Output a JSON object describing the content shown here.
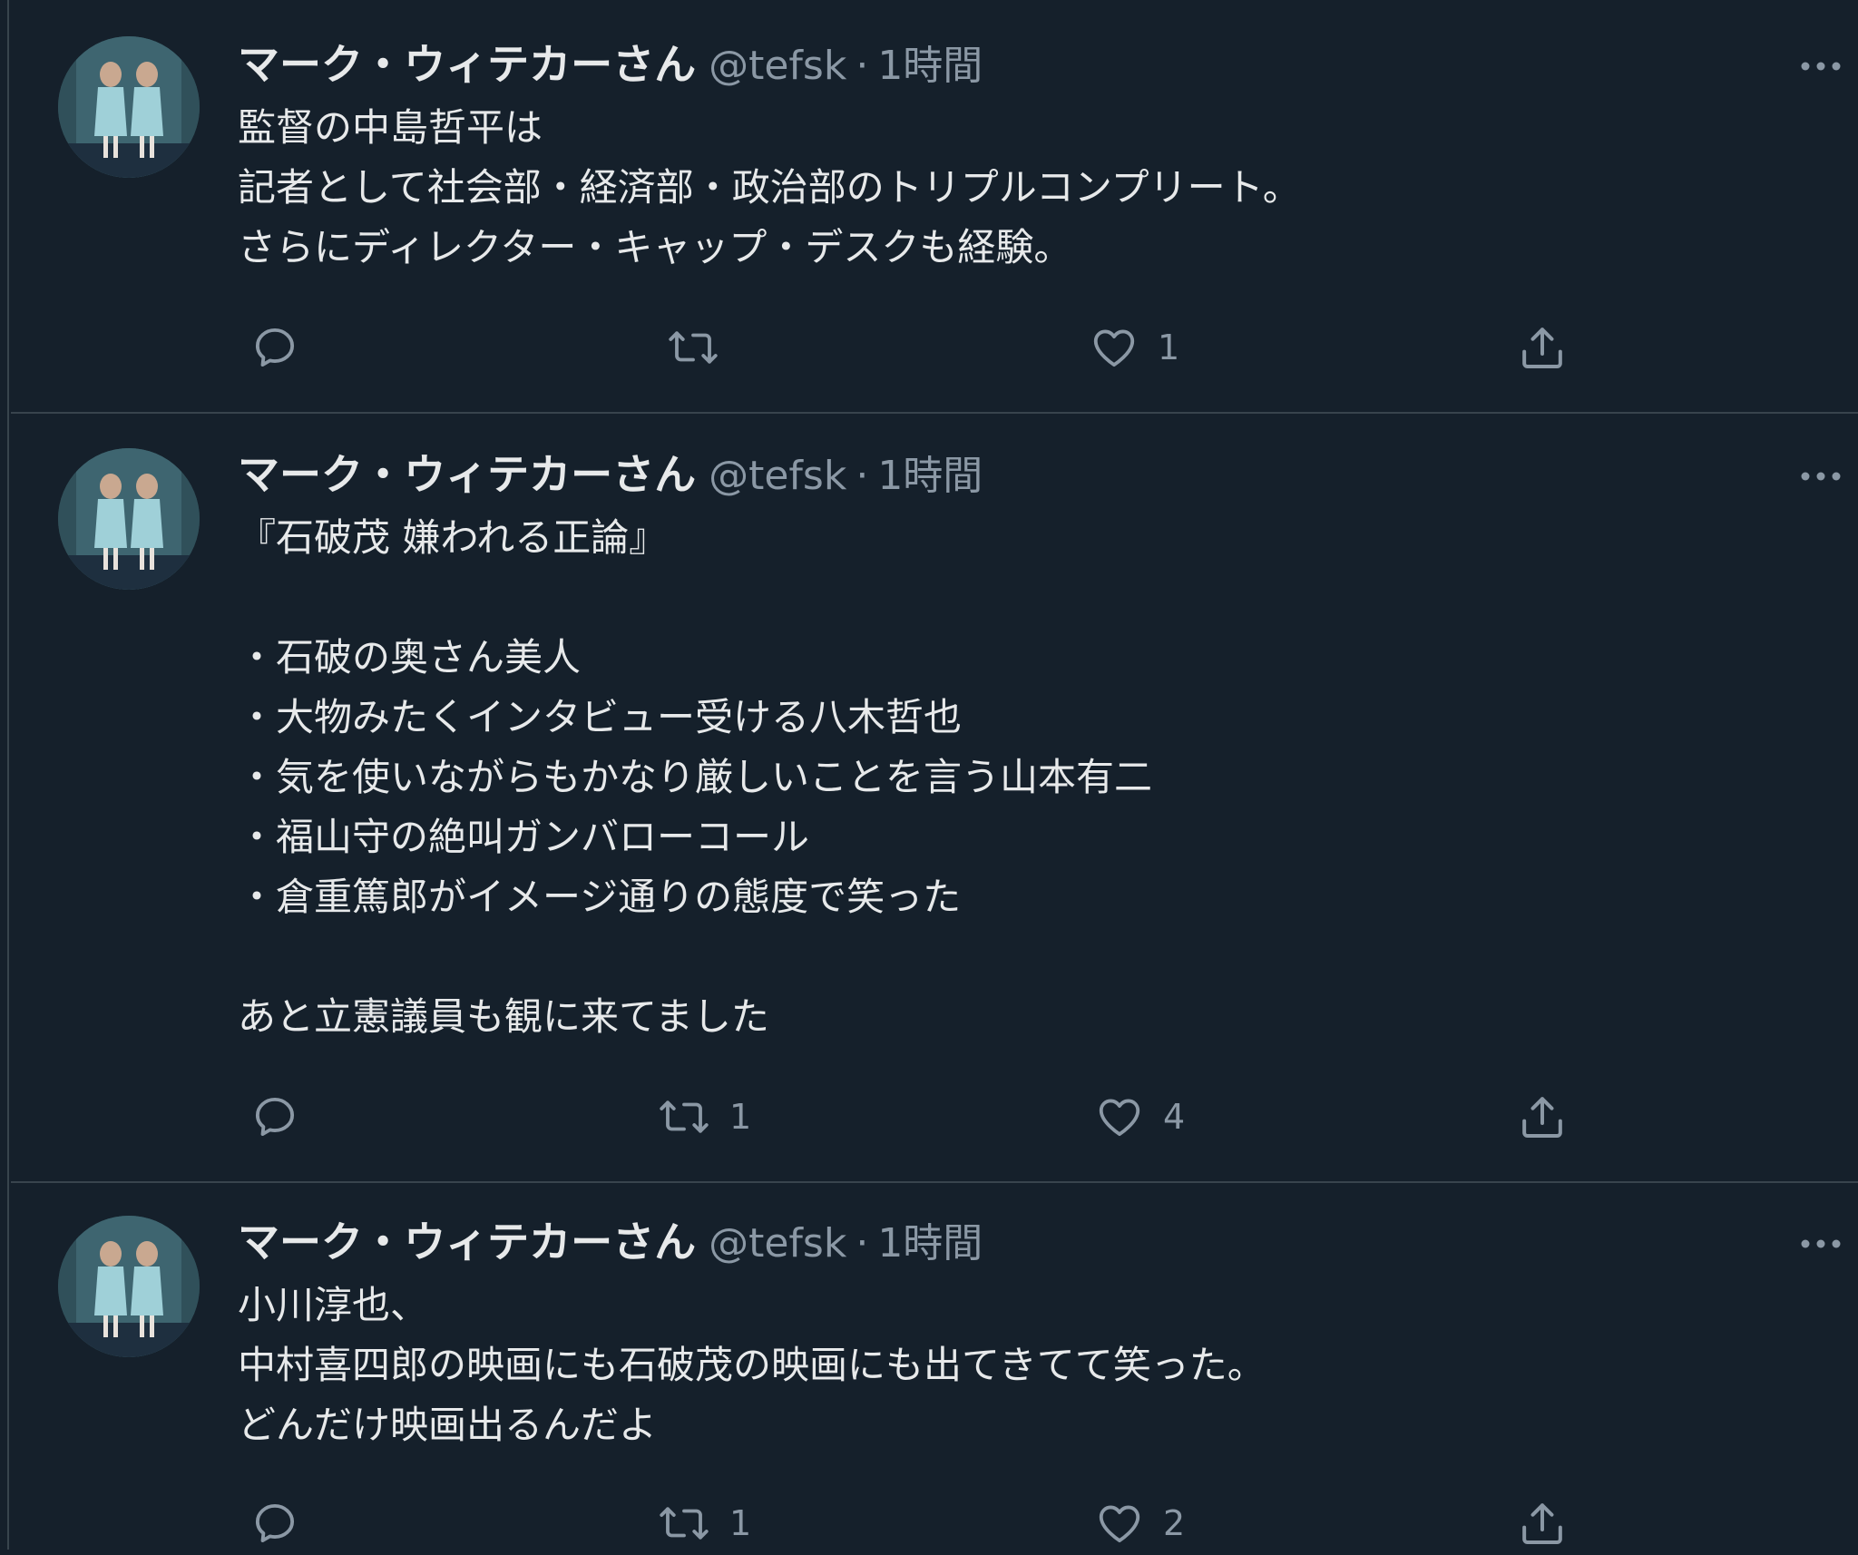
{
  "tweets": [
    {
      "name": "マーク・ウィテカーさん",
      "handle": "@tefsk",
      "sep": "·",
      "time": "1時間",
      "text": "監督の中島哲平は\n記者として社会部・経済部・政治部のトリプルコンプリート。\nさらにディレクター・キャップ・デスクも経験。",
      "reply_count": "",
      "retweet_count": "",
      "like_count": "1"
    },
    {
      "name": "マーク・ウィテカーさん",
      "handle": "@tefsk",
      "sep": "·",
      "time": "1時間",
      "text": "『石破茂 嫌われる正論』\n\n・石破の奥さん美人\n・大物みたくインタビュー受ける八木哲也\n・気を使いながらもかなり厳しいことを言う山本有二\n・福山守の絶叫ガンバローコール\n・倉重篤郎がイメージ通りの態度で笑った\n\nあと立憲議員も観に来てました",
      "reply_count": "",
      "retweet_count": "1",
      "like_count": "4"
    },
    {
      "name": "マーク・ウィテカーさん",
      "handle": "@tefsk",
      "sep": "·",
      "time": "1時間",
      "text": "小川淳也、\n中村喜四郎の映画にも石破茂の映画にも出てきてて笑った。\nどんだけ映画出るんだよ",
      "reply_count": "",
      "retweet_count": "1",
      "like_count": "2"
    }
  ],
  "icons": {
    "avatar": "avatar-image",
    "more": "more-icon",
    "reply": "reply-icon",
    "retweet": "retweet-icon",
    "like": "like-icon",
    "share": "share-icon"
  },
  "colors": {
    "background": "#15202b",
    "text": "#e7e9ea",
    "secondary": "#8b98a5",
    "divider": "#38444d"
  }
}
